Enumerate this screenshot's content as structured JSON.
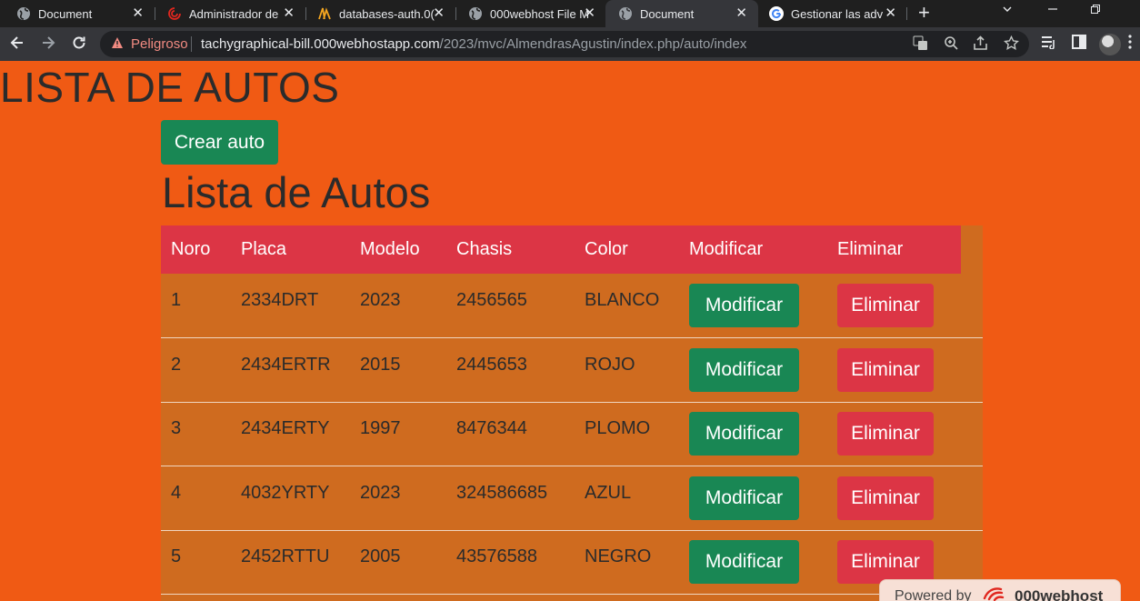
{
  "browser": {
    "tabs": [
      {
        "title": "Document",
        "icon": "globe-icon",
        "active": false
      },
      {
        "title": "Administrador de",
        "icon": "spiral-icon",
        "active": false
      },
      {
        "title": "databases-auth.0(",
        "icon": "sail-icon",
        "active": false
      },
      {
        "title": "000webhost File M",
        "icon": "globe-icon",
        "active": false
      },
      {
        "title": "Document",
        "icon": "globe-icon",
        "active": true
      },
      {
        "title": "Gestionar las adv",
        "icon": "google-icon",
        "active": false
      }
    ],
    "close_glyph": "✕",
    "new_tab_glyph": "+",
    "security_label": "Peligroso",
    "url_host": "tachygraphical-bill.000webhostapp.com",
    "url_path": "/2023/mvc/AlmendrasAgustin/index.php/auto/index"
  },
  "page": {
    "heading": "LISTA DE AUTOS",
    "create_button": "Crear auto",
    "subheading": "Lista de Autos",
    "table": {
      "headers": [
        "Noro",
        "Placa",
        "Modelo",
        "Chasis",
        "Color",
        "Modificar",
        "Eliminar"
      ],
      "rows": [
        {
          "num": "1",
          "placa": "2334DRT",
          "modelo": "2023",
          "chasis": "2456565",
          "color": "BLANCO"
        },
        {
          "num": "2",
          "placa": "2434ERTR",
          "modelo": "2015",
          "chasis": "2445653",
          "color": "ROJO"
        },
        {
          "num": "3",
          "placa": "2434ERTY",
          "modelo": "1997",
          "chasis": "8476344",
          "color": "PLOMO"
        },
        {
          "num": "4",
          "placa": "4032YRTY",
          "modelo": "2023",
          "chasis": "324586685",
          "color": "AZUL"
        },
        {
          "num": "5",
          "placa": "2452RTTU",
          "modelo": "2005",
          "chasis": "43576588",
          "color": "NEGRO"
        }
      ],
      "modify_label": "Modificar",
      "delete_label": "Eliminar"
    }
  },
  "footer": {
    "powered_label": "Powered by",
    "brand": "000webhost"
  },
  "colors": {
    "page_bg": "#f05a14",
    "table_bg": "#cf6b1f",
    "header_bg": "#dc3545",
    "success": "#198754",
    "danger": "#dc3545"
  }
}
